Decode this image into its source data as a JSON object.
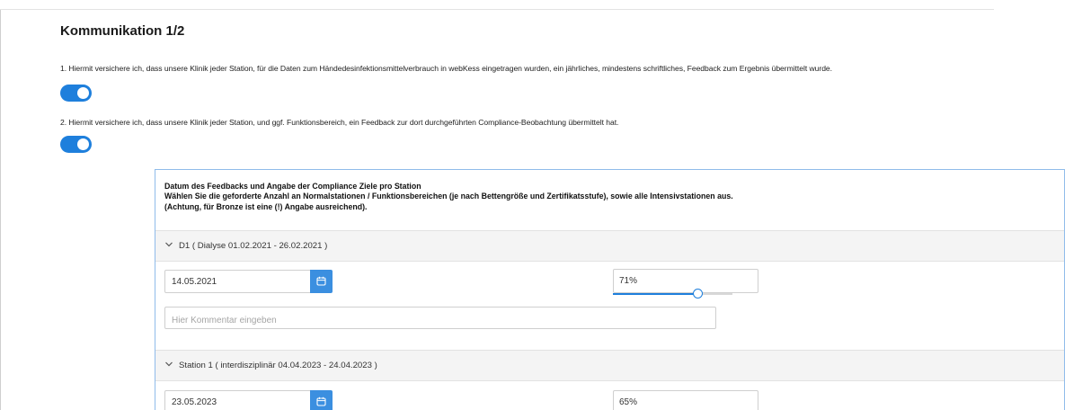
{
  "page": {
    "title": "Kommunikation 1/2"
  },
  "questions": [
    {
      "text": "1. Hiermit versichere ich, dass unsere Klinik jeder Station, für die Daten zum Händedesinfektionsmittelverbrauch in webKess eingetragen wurden, ein jährliches, mindestens schriftliches, Feedback zum Ergebnis übermittelt wurde.",
      "toggle_on": true
    },
    {
      "text": "2. Hiermit versichere ich, dass unsere Klinik jeder Station, und ggf. Funktionsbereich, ein Feedback zur dort durchgeführten Compliance-Beobachtung übermittelt hat.",
      "toggle_on": true
    }
  ],
  "panel": {
    "intro_lines": [
      "Datum des Feedbacks und Angabe der Compliance Ziele pro Station",
      "Wählen Sie die geforderte Anzahl an Normalstationen / Funktionsbereichen (je nach Bettengröße und Zertifikatsstufe), sowie alle Intensivstationen aus.",
      "(Achtung, für Bronze ist eine (!) Angabe ausreichend)."
    ],
    "sections": [
      {
        "label": "D1 ( Dialyse 01.02.2021 - 26.02.2021 )",
        "date": "14.05.2021",
        "compliance": "71%",
        "compliance_value": 71,
        "comment_placeholder": "Hier Kommentar eingeben",
        "comment_value": ""
      },
      {
        "label": "Station 1 ( interdisziplinär 04.04.2023 - 24.04.2023 )",
        "date": "23.05.2023",
        "compliance": "65%",
        "compliance_value": 65
      }
    ]
  },
  "icons": {
    "section_chevron": "chevron-down-icon",
    "date_button": "calendar-icon"
  },
  "colors": {
    "accent": "#1e7fdc",
    "calendar_button": "#3b8fe0",
    "panel_border": "#8fbbea",
    "section_header_bg": "#f4f4f4"
  }
}
